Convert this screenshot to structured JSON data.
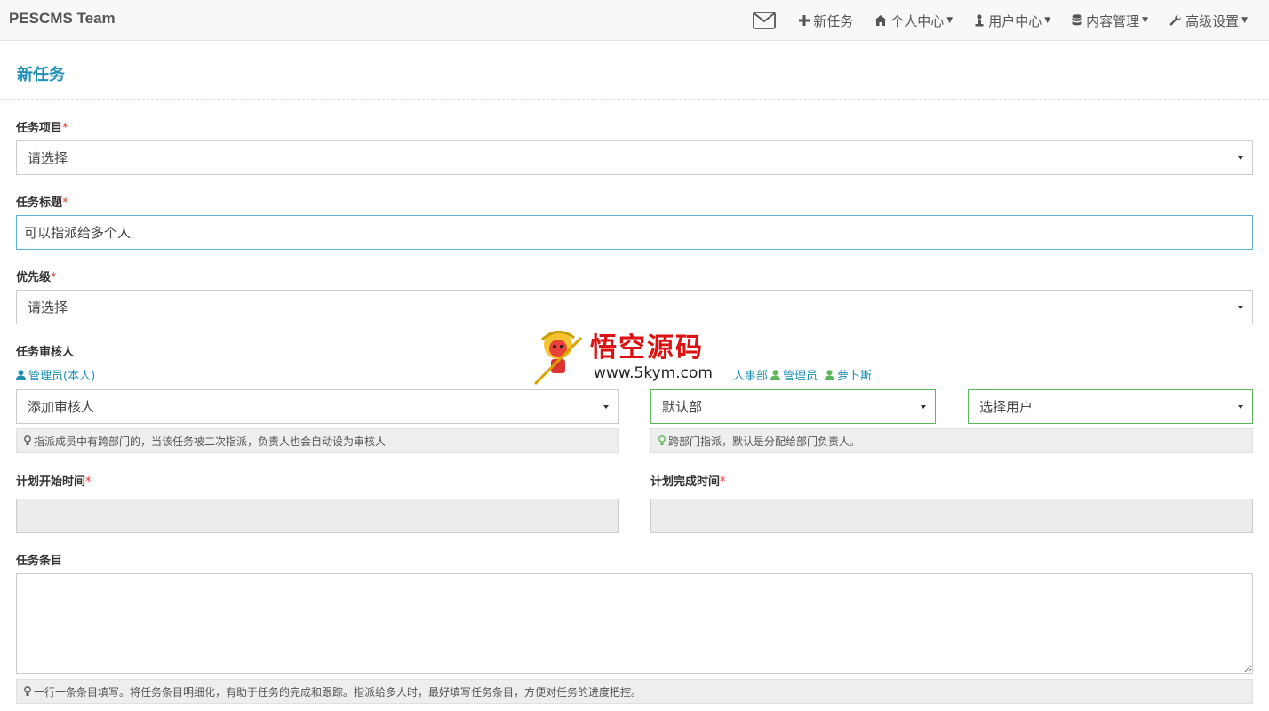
{
  "navbar": {
    "brand": "PESCMS Team",
    "items": [
      {
        "label": "新任务",
        "icon": "plus-icon"
      },
      {
        "label": "个人中心",
        "icon": "home-icon"
      },
      {
        "label": "用户中心",
        "icon": "user-icon"
      },
      {
        "label": "内容管理",
        "icon": "database-icon"
      },
      {
        "label": "高级设置",
        "icon": "wrench-icon"
      }
    ]
  },
  "page": {
    "title": "新任务"
  },
  "form": {
    "project": {
      "label": "任务项目",
      "required": "*",
      "value": "请选择"
    },
    "title": {
      "label": "任务标题",
      "required": "*",
      "value": "可以指派给多个人"
    },
    "priority": {
      "label": "优先级",
      "required": "*",
      "value": "请选择"
    },
    "reviewer": {
      "label": "任务审核人",
      "selected": "管理员(本人)",
      "select_value": "添加审核人",
      "hint": "指派成员中有跨部门的，当该任务被二次指派，负责人也会自动设为审核人"
    },
    "assign": {
      "selected_dept": "人事部",
      "selected_users": [
        "管理员",
        "萝卜斯"
      ],
      "dept_value": "默认部",
      "user_value": "选择用户",
      "hint": "跨部门指派，默认是分配给部门负责人。"
    },
    "start_time": {
      "label": "计划开始时间",
      "required": "*",
      "value": ""
    },
    "end_time": {
      "label": "计划完成时间",
      "required": "*",
      "value": ""
    },
    "items": {
      "label": "任务条目",
      "value": "",
      "hint": "一行一条条目填写。将任务条目明细化，有助于任务的完成和跟踪。指派给多人时，最好填写任务条目，方便对任务的进度把控。"
    }
  },
  "watermark": {
    "title": "悟空源码",
    "url": "www.5kym.com"
  },
  "colors": {
    "accent": "#1f8fb5",
    "required": "#e0362c",
    "user_icon_green": "#5cb85c"
  }
}
